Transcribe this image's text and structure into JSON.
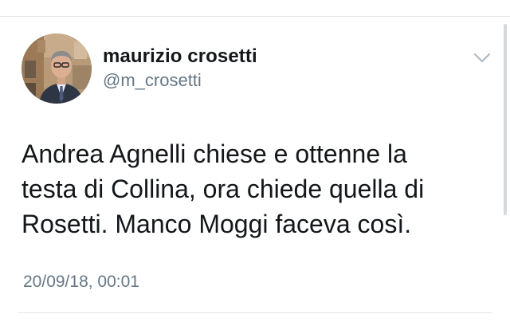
{
  "author": {
    "display_name": "maurizio crosetti",
    "handle": "@m_crosetti",
    "avatar_icon": "profile-photo"
  },
  "menu": {
    "icon": "chevron-down-icon"
  },
  "tweet": {
    "lines": [
      "Andrea Agnelli chiese e ottenne la",
      "testa di Collina, ora chiede quella di",
      "Rosetti. Manco Moggi faceva così."
    ],
    "timestamp": "20/09/18, 00:01"
  },
  "colors": {
    "text_primary": "#14171a",
    "text_secondary": "#657786",
    "divider": "#e1e5e8",
    "chevron": "#aab8c2"
  }
}
